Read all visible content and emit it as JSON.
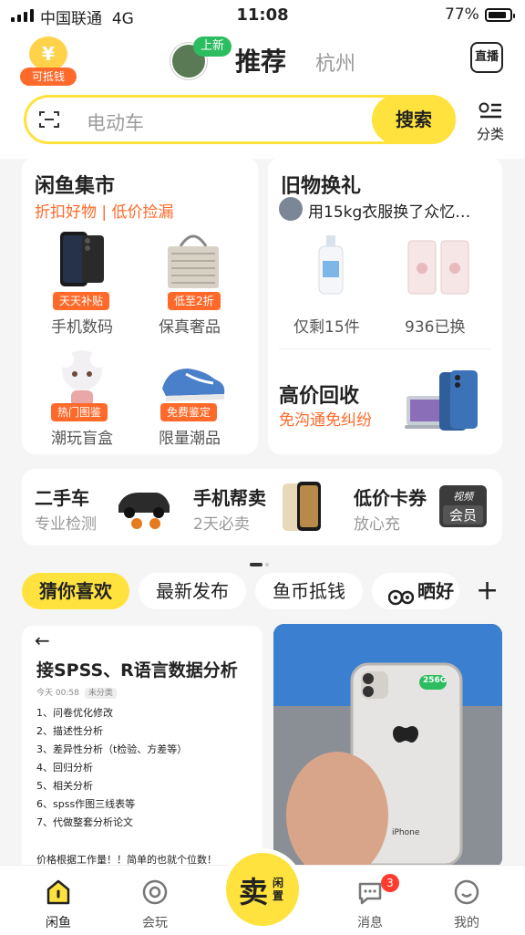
{
  "status_bar": {
    "carrier": "中国联通",
    "network": "4G",
    "time": "11:08",
    "battery": "77%"
  },
  "header": {
    "coin_badge": "可抵钱",
    "coin_symbol": "¥",
    "new_tag": "上新",
    "tab_recommend": "推荐",
    "tab_city": "杭州",
    "live_label": "直播"
  },
  "search": {
    "placeholder": "电动车",
    "button": "搜索",
    "category_label": "分类"
  },
  "market": {
    "title": "闲鱼集市",
    "subtitle": "折扣好物 | 低价捡漏",
    "items": [
      {
        "tag": "天天补贴",
        "label": "手机数码"
      },
      {
        "tag": "低至2折",
        "label": "保真奢品"
      },
      {
        "tag": "热门图鉴",
        "label": "潮玩盲盒"
      },
      {
        "tag": "免费鉴定",
        "label": "限量潮品"
      }
    ]
  },
  "exchange": {
    "title": "旧物换礼",
    "ticker": "用15kg衣服换了众忆…",
    "left_label": "仅剩15件",
    "right_label": "936已换",
    "recycle_title": "高价回收",
    "recycle_sub": "免沟通免纠纷"
  },
  "strip": [
    {
      "title": "二手车",
      "sub": "专业检测"
    },
    {
      "title": "手机帮卖",
      "sub": "2天必卖"
    },
    {
      "title": "低价卡券",
      "sub": "放心充",
      "badge_top": "视频",
      "badge_bottom": "会员"
    }
  ],
  "feed_tabs": [
    "猜你喜欢",
    "最新发布",
    "鱼币抵钱",
    "晒好"
  ],
  "feed_tab_plus": "+",
  "feed_left": {
    "back": "←",
    "title": "接SPSS、R语言数据分析",
    "date": "今天 00:58",
    "category": "未分类",
    "list": [
      "1、问卷优化修改",
      "2、描述性分析",
      "3、差异性分析（t检验、方差等）",
      "4、回归分析",
      "5、相关分析",
      "6、spss作图三线表等",
      "7、代做整套分析论文"
    ],
    "price_note": "价格根据工作量！！简单的也就个位数！"
  },
  "feed_right": {
    "storage": "256G",
    "brand": "iPhone"
  },
  "tabbar": {
    "home": "闲鱼",
    "play": "会玩",
    "sell_big": "卖",
    "sell_small": "闲置",
    "message": "消息",
    "message_count": "3",
    "mine": "我的"
  }
}
